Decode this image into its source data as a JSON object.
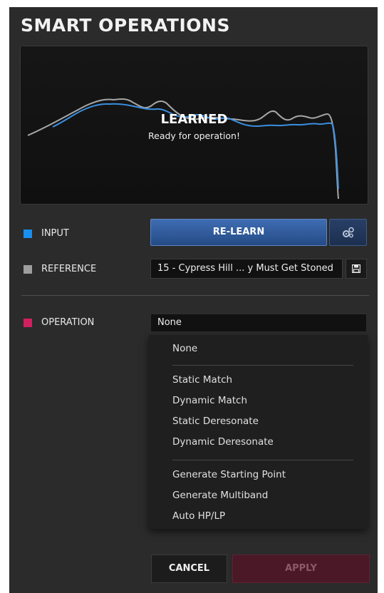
{
  "panel": {
    "title": "SMART OPERATIONS"
  },
  "display": {
    "status_title": "LEARNED",
    "status_subtitle": "Ready for operation!",
    "colors": {
      "input_curve": "#3a8fe0",
      "reference_curve": "#a7a7a7"
    }
  },
  "input_row": {
    "label": "INPUT",
    "color": "#1a8ff0",
    "relearn_label": "RE-LEARN",
    "settings_icon": "gears-icon"
  },
  "reference_row": {
    "label": "REFERENCE",
    "color": "#9e9e9e",
    "value": "15 - Cypress Hill ... y Must Get Stoned",
    "save_icon": "save-icon"
  },
  "operation_row": {
    "label": "OPERATION",
    "color": "#d0215e",
    "selected": "None",
    "options": [
      "None",
      "Static Match",
      "Dynamic Match",
      "Static Deresonate",
      "Dynamic Deresonate",
      "Generate Starting Point",
      "Generate Multiband",
      "Auto HP/LP"
    ]
  },
  "footer": {
    "cancel_label": "CANCEL",
    "apply_label": "APPLY"
  }
}
